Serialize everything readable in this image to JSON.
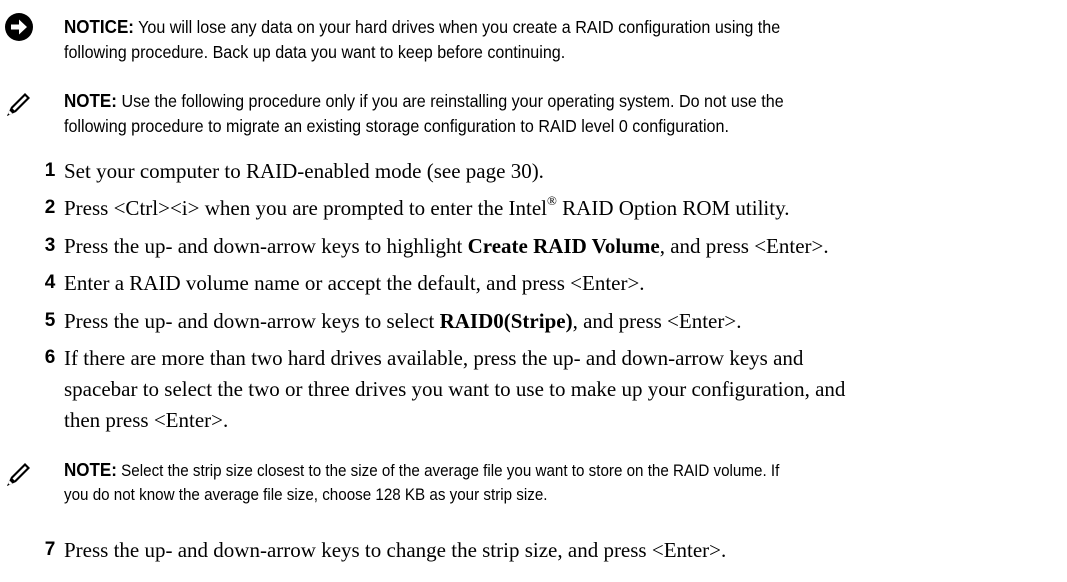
{
  "notice": {
    "icon": "arrow-right-circle-icon",
    "label": "NOTICE:",
    "line1": "You will lose any data on your hard drives when you create a RAID configuration using the",
    "line2": "following procedure. Back up data you want to keep before continuing."
  },
  "note1": {
    "icon": "pencil-icon",
    "label": "NOTE:",
    "line1": "Use the following procedure only if you are reinstalling your operating system. Do not use the",
    "line2": "following procedure to migrate an existing storage configuration to RAID level 0 configuration."
  },
  "steps": [
    {
      "num": "1",
      "text": "Set your computer to RAID-enabled mode (see page 30)."
    },
    {
      "num": "2",
      "pre": "Press <Ctrl><i> when you are prompted to enter the Intel",
      "sup": "®",
      "post": " RAID Option ROM utility."
    },
    {
      "num": "3",
      "pre": "Press the up- and down-arrow keys to highlight ",
      "bold": "Create RAID Volume",
      "post": ", and press <Enter>."
    },
    {
      "num": "4",
      "text": "Enter a RAID volume name or accept the default, and press <Enter>."
    },
    {
      "num": "5",
      "pre": "Press the up- and down-arrow keys to select ",
      "bold": "RAID0(Stripe)",
      "post": ", and press <Enter>."
    },
    {
      "num": "6",
      "line1": "If there are more than two hard drives available, press the up- and down-arrow keys and",
      "line2": "spacebar to select the two or three drives you want to use to make up your configuration, and",
      "line3": "then press <Enter>."
    },
    {
      "num": "7",
      "text": "Press the up- and down-arrow keys to change the strip size, and press <Enter>."
    }
  ],
  "note2": {
    "icon": "pencil-icon",
    "label": "NOTE:",
    "line1": "Select the strip size closest to the size of the average file you want to store on the RAID volume. If",
    "line2": "you do not know the average file size, choose 128 KB as your strip size."
  }
}
